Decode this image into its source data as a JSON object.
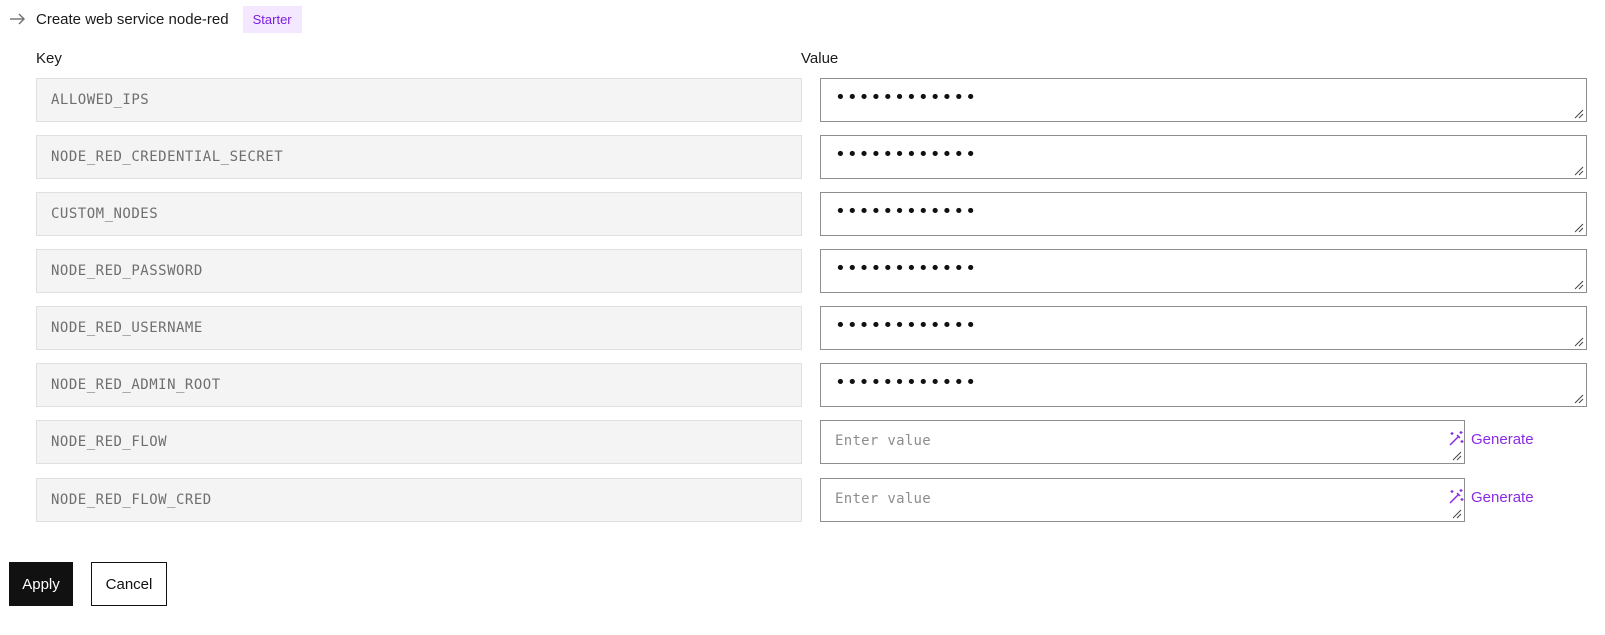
{
  "header": {
    "icon": "arrow-right-icon",
    "title": "Create web service node-red",
    "badge": "Starter"
  },
  "columns": {
    "key": "Key",
    "value": "Value"
  },
  "rows": [
    {
      "key": "ALLOWED_IPS",
      "value": "••••••••••••"
    },
    {
      "key": "NODE_RED_CREDENTIAL_SECRET",
      "value": "••••••••••••"
    },
    {
      "key": "CUSTOM_NODES",
      "value": "••••••••••••"
    },
    {
      "key": "NODE_RED_PASSWORD",
      "value": "••••••••••••"
    },
    {
      "key": "NODE_RED_USERNAME",
      "value": "••••••••••••"
    },
    {
      "key": "NODE_RED_ADMIN_ROOT",
      "value": "••••••••••••"
    },
    {
      "key": "NODE_RED_FLOW",
      "placeholder": "Enter value",
      "generate_label": "Generate"
    },
    {
      "key": "NODE_RED_FLOW_CRED",
      "placeholder": "Enter value",
      "generate_label": "Generate"
    }
  ],
  "actions": {
    "apply": "Apply",
    "cancel": "Cancel"
  },
  "colors": {
    "accent": "#8a2be2",
    "badge_bg": "#f3e8ff",
    "primary_button": "#111111"
  }
}
